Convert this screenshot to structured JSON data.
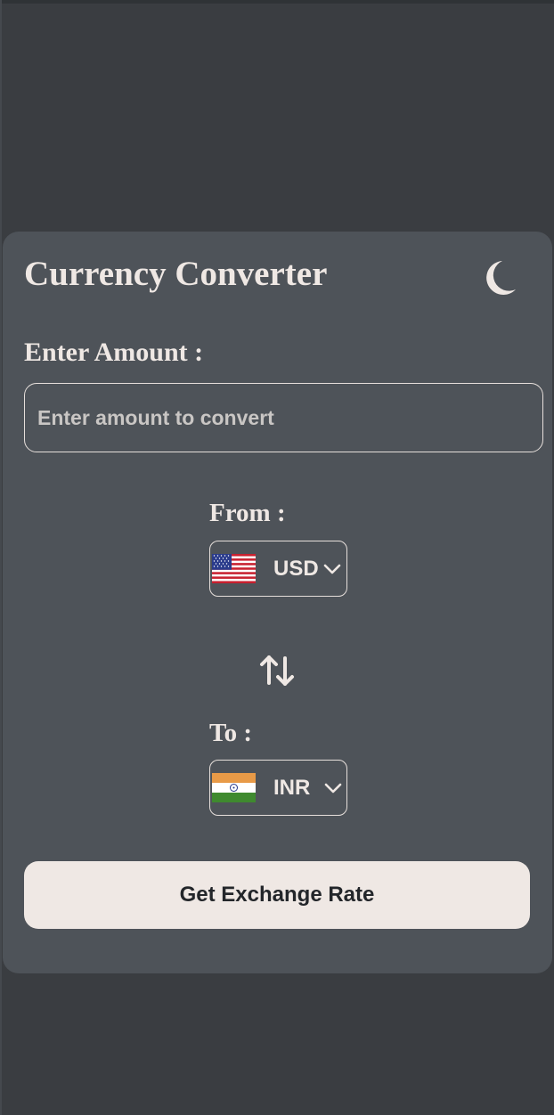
{
  "app": {
    "title": "Currency Converter",
    "theme_toggle_icon": "moon-icon"
  },
  "amount": {
    "label": "Enter Amount :",
    "value": "",
    "placeholder": "Enter amount to convert"
  },
  "from": {
    "label": "From :",
    "currency": "USD",
    "flag": "us-flag-icon"
  },
  "swap": {
    "icon": "swap-arrows-icon"
  },
  "to": {
    "label": "To :",
    "currency": "INR",
    "flag": "india-flag-icon"
  },
  "action": {
    "label": "Get Exchange Rate"
  },
  "colors": {
    "background": "#3a3d41",
    "card": "#4e5359",
    "text": "#efe8e4",
    "button_bg": "#efe8e4",
    "button_text": "#23262a"
  }
}
